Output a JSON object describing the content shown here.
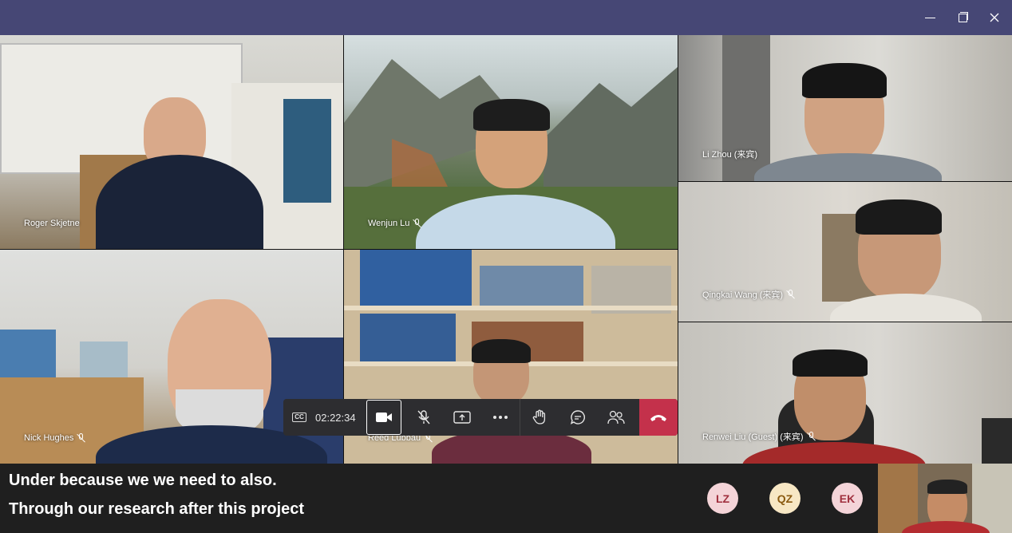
{
  "window": {
    "controls": {
      "minimize": "minimize",
      "maximize": "restore",
      "close": "close"
    }
  },
  "participants": [
    {
      "name": "Roger Skjetne",
      "muted": false
    },
    {
      "name": "Wenjun Lu",
      "muted": true
    },
    {
      "name": "Li Zhou (来宾)",
      "muted": false
    },
    {
      "name": "Qingkai Wang (来宾)",
      "muted": true
    },
    {
      "name": "Nick Hughes",
      "muted": true
    },
    {
      "name": "Reed Lubbau",
      "muted": true
    },
    {
      "name": "Renwei Liu (Guest) (来宾)",
      "muted": true
    }
  ],
  "controls": {
    "cc_label": "CC",
    "call_timer": "02:22:34"
  },
  "captions": {
    "line1": "Under because we we need to also.",
    "line2": "Through our research after this project"
  },
  "overflow_avatars": [
    {
      "initials": "LZ",
      "bg": "#f4d4d8",
      "fg": "#a0303e"
    },
    {
      "initials": "QZ",
      "bg": "#f7e7c4",
      "fg": "#8a5a10"
    },
    {
      "initials": "EK",
      "bg": "#f4d4d8",
      "fg": "#a0303e"
    }
  ],
  "colors": {
    "titlebar": "#464775",
    "hangup": "#c4314b",
    "control_bar": "#2d2d30"
  }
}
